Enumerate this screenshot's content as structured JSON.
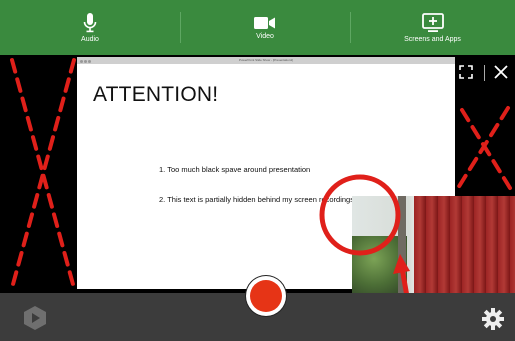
{
  "toolbar": {
    "audio_label": "Audio",
    "video_label": "Video",
    "screens_label": "Screens and Apps"
  },
  "presentation": {
    "window_title": "PowerPoint Slide Show - [Presentation1]",
    "title": "ATTENTION!",
    "points": [
      "1.  Too much black spave around presentation",
      "2. This text is partially hidden behind my screen recordings"
    ]
  },
  "colors": {
    "toolbar_bg": "#3a8a3e",
    "annotation_red": "#e0201a",
    "record_red": "#e63416",
    "bottom_bar_bg": "#3c3c3c"
  },
  "icons": [
    "microphone-icon",
    "video-camera-icon",
    "screen-share-icon",
    "fullscreen-icon",
    "close-icon",
    "app-logo-icon",
    "gear-icon"
  ]
}
